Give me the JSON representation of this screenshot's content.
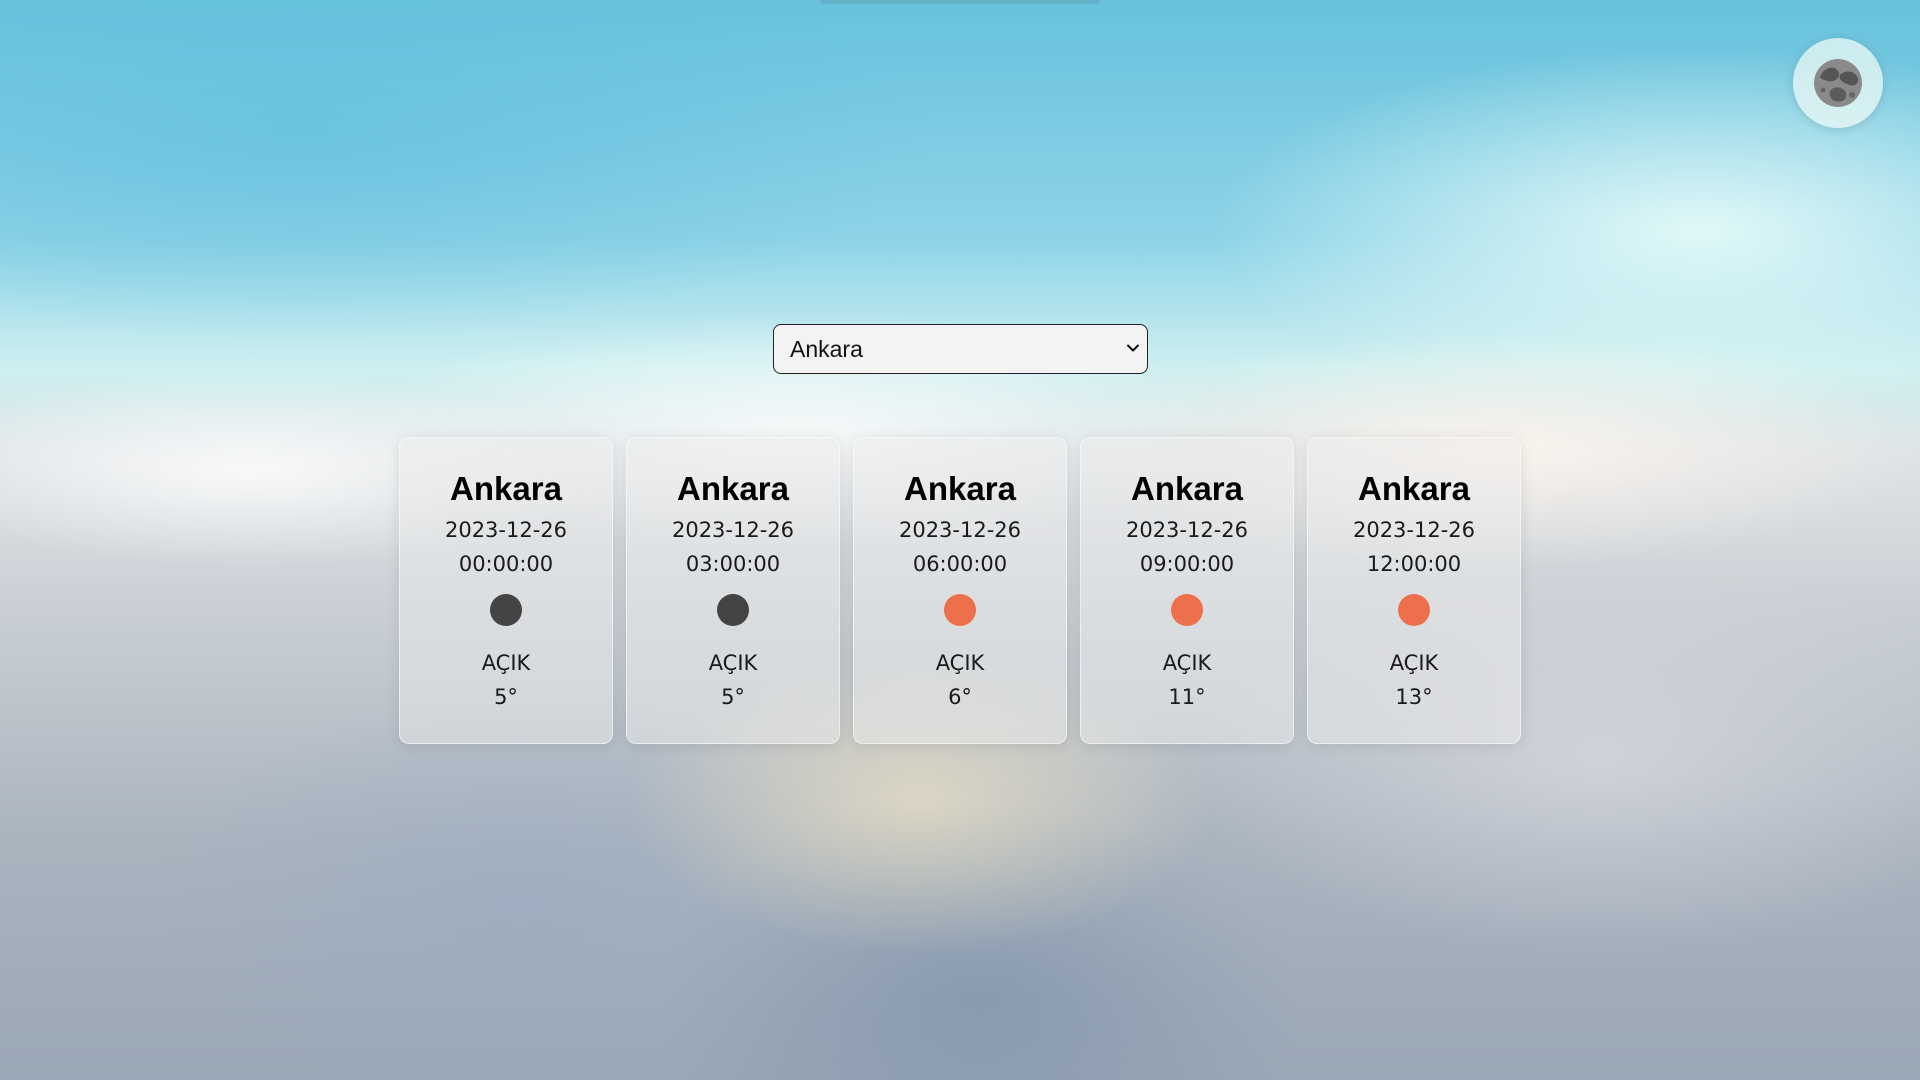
{
  "city_select": {
    "selected": "Ankara",
    "options": [
      "Ankara"
    ]
  },
  "theme_toggle": {
    "icon": "moon-icon",
    "colors": {
      "bg": "#ebf8f6",
      "moon": "#8a8a8a",
      "craters": "#555555"
    }
  },
  "forecast": [
    {
      "city": "Ankara",
      "date": "2023-12-26",
      "time": "00:00:00",
      "icon": "night-dot-icon",
      "icon_color": "#444444",
      "condition": "AÇIK",
      "temp": "5°"
    },
    {
      "city": "Ankara",
      "date": "2023-12-26",
      "time": "03:00:00",
      "icon": "night-dot-icon",
      "icon_color": "#444444",
      "condition": "AÇIK",
      "temp": "5°"
    },
    {
      "city": "Ankara",
      "date": "2023-12-26",
      "time": "06:00:00",
      "icon": "sun-dot-icon",
      "icon_color": "#ee6f4c",
      "condition": "AÇIK",
      "temp": "6°"
    },
    {
      "city": "Ankara",
      "date": "2023-12-26",
      "time": "09:00:00",
      "icon": "sun-dot-icon",
      "icon_color": "#ee6f4c",
      "condition": "AÇIK",
      "temp": "11°"
    },
    {
      "city": "Ankara",
      "date": "2023-12-26",
      "time": "12:00:00",
      "icon": "sun-dot-icon",
      "icon_color": "#ee6f4c",
      "condition": "AÇIK",
      "temp": "13°"
    }
  ]
}
